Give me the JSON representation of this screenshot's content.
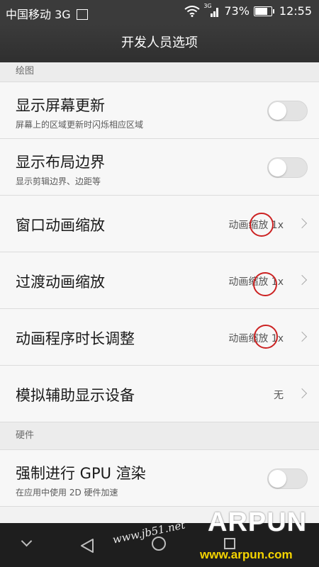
{
  "status_bar": {
    "carrier": "中国移动",
    "network": "3G",
    "signal_network": "3G",
    "battery": "73%",
    "time": "12:55",
    "icons": [
      "sim-icon",
      "wifi-icon",
      "signal-icon",
      "battery-icon"
    ]
  },
  "title_bar": {
    "title": "开发人员选项"
  },
  "sections": {
    "drawing": {
      "header": "绘图",
      "show_screen_updates": {
        "title": "显示屏幕更新",
        "subtitle": "屏幕上的区域更新时闪烁相应区域",
        "toggle_on": false
      },
      "show_layout_bounds": {
        "title": "显示布局边界",
        "subtitle": "显示剪辑边界、边距等",
        "toggle_on": false
      },
      "window_animation_scale": {
        "title": "窗口动画缩放",
        "value": "动画缩放 1x"
      },
      "transition_animation_scale": {
        "title": "过渡动画缩放",
        "value": "动画缩放 1x"
      },
      "animator_duration_scale": {
        "title": "动画程序时长调整",
        "value": "动画缩放 1x"
      },
      "simulate_secondary_displays": {
        "title": "模拟辅助显示设备",
        "value": "无"
      }
    },
    "hardware": {
      "header": "硬件",
      "force_gpu_rendering": {
        "title": "强制进行 GPU 渲染",
        "subtitle": "在应用中使用 2D 硬件加速",
        "toggle_on": false
      }
    }
  },
  "nav_bar": {
    "icons": [
      "chevron-down-icon",
      "back-icon",
      "home-icon",
      "recent-apps-icon"
    ]
  },
  "watermarks": {
    "jb51": "www.jb51.net",
    "logo": "ARPUN",
    "url": "www.arpun.com"
  },
  "colors": {
    "status_bar_bg": "#3b3b3b",
    "list_bg": "#f7f7f7",
    "annotation_circle": "#cc2222",
    "watermark_url": "#f5d400"
  }
}
